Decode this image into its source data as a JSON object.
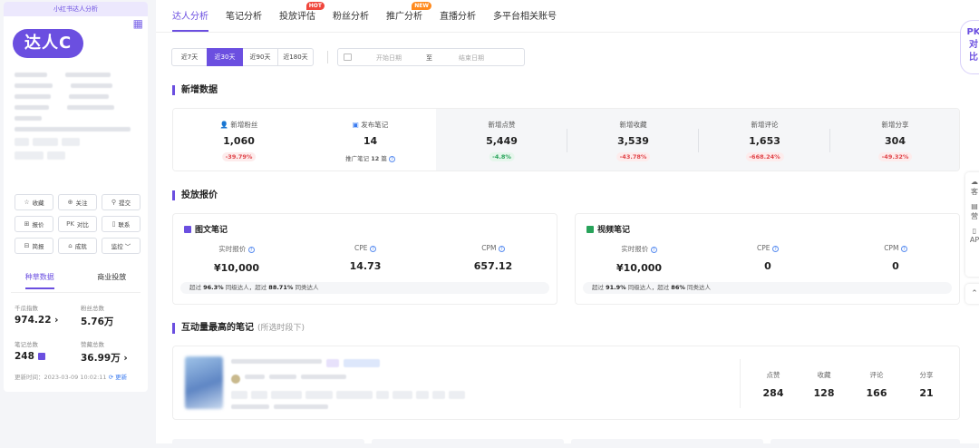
{
  "sidebar": {
    "header": "小红书达人分析",
    "badge": "达人C",
    "actions": [
      {
        "icon": "☆",
        "label": "收藏"
      },
      {
        "icon": "⊕",
        "label": "关注"
      },
      {
        "icon": "⚲",
        "label": "提交"
      },
      {
        "icon": "⊞",
        "label": "报价"
      },
      {
        "icon": "PK",
        "label": "对比"
      },
      {
        "icon": "▯",
        "label": "联系"
      },
      {
        "icon": "⊟",
        "label": "简报"
      },
      {
        "icon": "⌂",
        "label": "成就"
      },
      {
        "icon": "",
        "label": "监控 ﹀"
      }
    ],
    "tabs": [
      "种草数据",
      "商业投放"
    ],
    "stats": [
      {
        "label": "千瓜指数",
        "value": "974.22 ›"
      },
      {
        "label": "粉丝总数",
        "value": "5.76万"
      },
      {
        "label": "笔记总数",
        "value": "248"
      },
      {
        "label": "赞藏总数",
        "value": "36.99万 ›"
      }
    ],
    "update_time": "更新时间：2023-03-09 10:02:11",
    "refresh": "⟳ 更新"
  },
  "tabs": [
    {
      "label": "达人分析"
    },
    {
      "label": "笔记分析"
    },
    {
      "label": "投放评估",
      "tag": "HOT",
      "tag_color": "#f0463c"
    },
    {
      "label": "粉丝分析"
    },
    {
      "label": "推广分析",
      "tag": "NEW",
      "tag_color": "#ff8a1e"
    },
    {
      "label": "直播分析"
    },
    {
      "label": "多平台相关账号"
    }
  ],
  "date_range": {
    "options": [
      "近7天",
      "近30天",
      "近90天",
      "近180天"
    ],
    "selected": "近30天",
    "start_placeholder": "开始日期",
    "sep": "至",
    "end_placeholder": "结束日期"
  },
  "new_data": {
    "title": "新增数据",
    "fans": {
      "label": "新增粉丝",
      "value": "1,060",
      "change": "-39.79%",
      "trend": "red"
    },
    "notes": {
      "label": "发布笔记",
      "value": "14",
      "sub_prefix": "推广笔记",
      "sub_value": "12",
      "sub_suffix": "篇"
    },
    "metrics": [
      {
        "label": "新增点赞",
        "value": "5,449",
        "change": "-4.8%",
        "trend": "green"
      },
      {
        "label": "新增收藏",
        "value": "3,539",
        "change": "-43.78%",
        "trend": "red"
      },
      {
        "label": "新增评论",
        "value": "1,653",
        "change": "-668.24%",
        "trend": "red"
      },
      {
        "label": "新增分享",
        "value": "304",
        "change": "-49.32%",
        "trend": "red"
      }
    ]
  },
  "pricing": {
    "title": "投放报价",
    "cards": [
      {
        "title": "图文笔记",
        "icon_color": "#6b4fe0",
        "cols": [
          {
            "label": "实时报价",
            "value": "¥10,000"
          },
          {
            "label": "CPE",
            "value": "14.73"
          },
          {
            "label": "CPM",
            "value": "657.12"
          }
        ],
        "bar": {
          "p1": "超过",
          "v1": "96.3%",
          "p2": "同级达人，超过",
          "v2": "88.71%",
          "p3": "同类达人"
        }
      },
      {
        "title": "视频笔记",
        "icon_color": "#28a35a",
        "cols": [
          {
            "label": "实时报价",
            "value": "¥10,000"
          },
          {
            "label": "CPE",
            "value": "0"
          },
          {
            "label": "CPM",
            "value": "0"
          }
        ],
        "bar": {
          "p1": "超过",
          "v1": "91.9%",
          "p2": "同级达人，超过",
          "v2": "86%",
          "p3": "同类达人"
        }
      }
    ]
  },
  "top_note": {
    "title": "互动量最高的笔记",
    "subtitle": "(所选时段下)",
    "stats": [
      {
        "label": "点赞",
        "value": "284"
      },
      {
        "label": "收藏",
        "value": "128"
      },
      {
        "label": "评论",
        "value": "166"
      },
      {
        "label": "分享",
        "value": "21"
      }
    ]
  },
  "right_float": {
    "pk_line1": "PK",
    "pk_line2": "对",
    "pk_line3": "比",
    "items": [
      "客",
      "营",
      "AP"
    ],
    "top_icon": "⌃"
  }
}
